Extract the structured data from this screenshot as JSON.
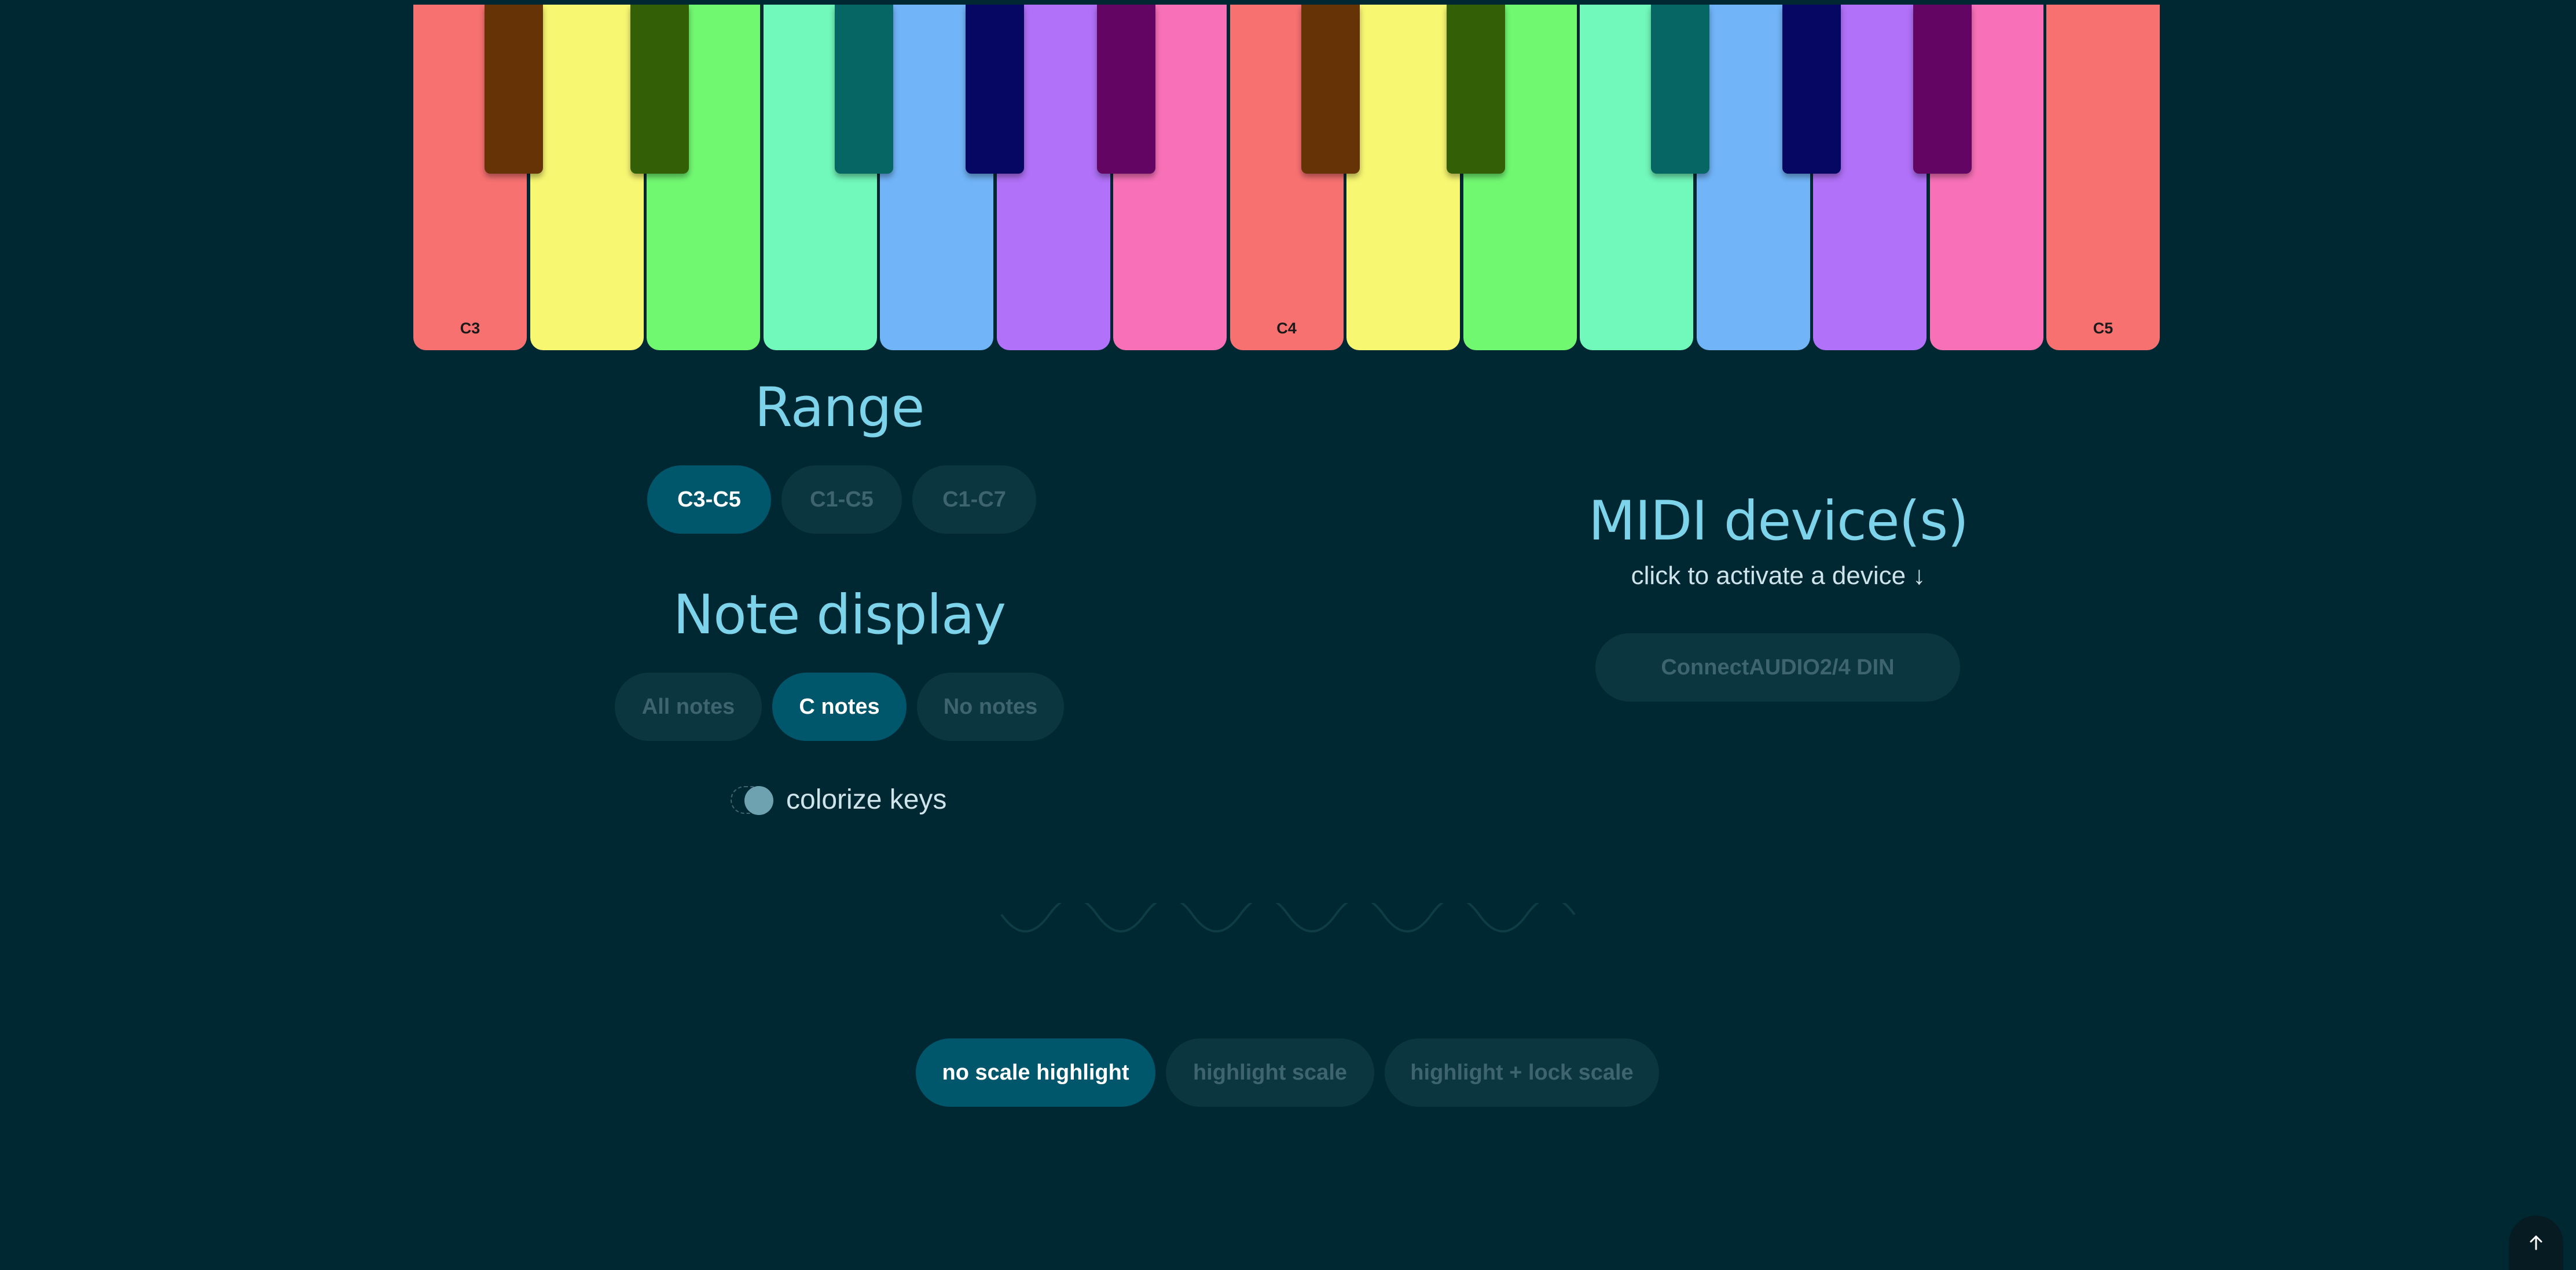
{
  "keyboard": {
    "white_keys": [
      {
        "note": "C3",
        "label": "C3",
        "color": "#f87171"
      },
      {
        "note": "D3",
        "label": "",
        "color": "#f8f771"
      },
      {
        "note": "E3",
        "label": "",
        "color": "#71f871"
      },
      {
        "note": "F3",
        "label": "",
        "color": "#71f8bb"
      },
      {
        "note": "G3",
        "label": "",
        "color": "#71b4f8"
      },
      {
        "note": "A3",
        "label": "",
        "color": "#b171f8"
      },
      {
        "note": "B3",
        "label": "",
        "color": "#f871b8"
      },
      {
        "note": "C4",
        "label": "C4",
        "color": "#f87171"
      },
      {
        "note": "D4",
        "label": "",
        "color": "#f8f771"
      },
      {
        "note": "E4",
        "label": "",
        "color": "#71f871"
      },
      {
        "note": "F4",
        "label": "",
        "color": "#71f8bb"
      },
      {
        "note": "G4",
        "label": "",
        "color": "#71b4f8"
      },
      {
        "note": "A4",
        "label": "",
        "color": "#b171f8"
      },
      {
        "note": "B4",
        "label": "",
        "color": "#f871b8"
      },
      {
        "note": "C5",
        "label": "C5",
        "color": "#f87171"
      }
    ],
    "black_keys": [
      {
        "note": "C#3",
        "color": "#653306"
      },
      {
        "note": "D#3",
        "color": "#336006"
      },
      {
        "note": "F#3",
        "color": "#066663"
      },
      {
        "note": "G#3",
        "color": "#060663"
      },
      {
        "note": "A#3",
        "color": "#630663"
      },
      {
        "note": "C#4",
        "color": "#653306"
      },
      {
        "note": "D#4",
        "color": "#336006"
      },
      {
        "note": "F#4",
        "color": "#066663"
      },
      {
        "note": "G#4",
        "color": "#060663"
      },
      {
        "note": "A#4",
        "color": "#630663"
      }
    ]
  },
  "range": {
    "title": "Range",
    "options": [
      {
        "label": "C3-C5",
        "active": true
      },
      {
        "label": "C1-C5",
        "active": false
      },
      {
        "label": "C1-C7",
        "active": false
      }
    ]
  },
  "note_display": {
    "title": "Note display",
    "options": [
      {
        "label": "All notes",
        "active": false
      },
      {
        "label": "C notes",
        "active": true
      },
      {
        "label": "No notes",
        "active": false
      }
    ]
  },
  "colorize": {
    "label": "colorize keys",
    "enabled": true
  },
  "midi": {
    "title": "MIDI device(s)",
    "subtitle": "click to activate a device ↓",
    "devices": [
      {
        "label": "ConnectAUDIO2/4 DIN",
        "active": false
      }
    ]
  },
  "scale": {
    "options": [
      {
        "label": "no scale highlight",
        "active": true
      },
      {
        "label": "highlight scale",
        "active": false
      },
      {
        "label": "highlight + lock scale",
        "active": false
      }
    ]
  },
  "icons": {
    "scroll_top": "arrow-up-icon",
    "divider": "wave-divider-icon"
  },
  "colors": {
    "background": "#002833",
    "accent": "#7dd3ea",
    "pill_active": "#00566b",
    "pill_inactive": "#0b3640"
  }
}
